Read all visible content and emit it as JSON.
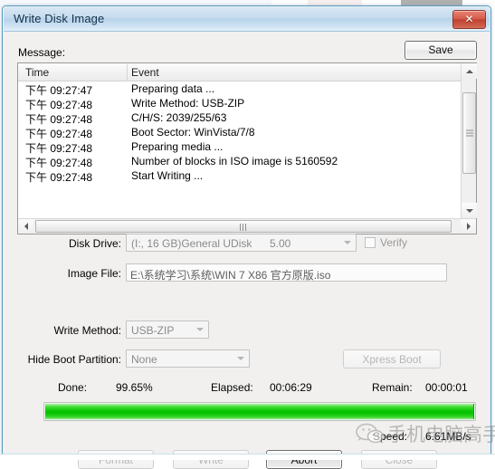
{
  "window": {
    "title": "Write Disk Image",
    "close_icon": "close-x-icon"
  },
  "message": {
    "label": "Message:",
    "save_label": "Save"
  },
  "list": {
    "columns": [
      "Time",
      "Event"
    ],
    "rows": [
      {
        "time": "下午 09:27:47",
        "event": "Preparing data ..."
      },
      {
        "time": "下午 09:27:48",
        "event": "Write Method: USB-ZIP"
      },
      {
        "time": "下午 09:27:48",
        "event": "C/H/S: 2039/255/63"
      },
      {
        "time": "下午 09:27:48",
        "event": "Boot Sector: WinVista/7/8"
      },
      {
        "time": "下午 09:27:48",
        "event": "Preparing media ..."
      },
      {
        "time": "下午 09:27:48",
        "event": "Number of blocks in ISO image is 5160592"
      },
      {
        "time": "下午 09:27:48",
        "event": "Start Writing ..."
      }
    ]
  },
  "form": {
    "disk_drive_label": "Disk Drive:",
    "disk_drive_value": "(I:, 16 GB)General UDisk",
    "disk_drive_version": "5.00",
    "verify_label": "Verify",
    "verify_checked": false,
    "image_file_label": "Image File:",
    "image_file_value": "E:\\系统学习\\系统\\WIN 7     X86 官方原版.iso",
    "write_method_label": "Write Method:",
    "write_method_value": "USB-ZIP",
    "hide_boot_label": "Hide Boot Partition:",
    "hide_boot_value": "None",
    "xpress_boot_label": "Xpress Boot"
  },
  "status": {
    "done_label": "Done:",
    "done_value": "99.65%",
    "elapsed_label": "Elapsed:",
    "elapsed_value": "00:06:29",
    "remain_label": "Remain:",
    "remain_value": "00:00:01",
    "speed_label": "Speed:",
    "speed_value": "6.61MB/s",
    "progress_percent": 99.65,
    "progress_color": "#0ecb06"
  },
  "buttons": {
    "format": "Format",
    "write": "Write",
    "abort": "Abort",
    "close": "Close"
  },
  "watermark": {
    "text": "手机电脑高手",
    "logo_icon": "wechat-icon"
  }
}
